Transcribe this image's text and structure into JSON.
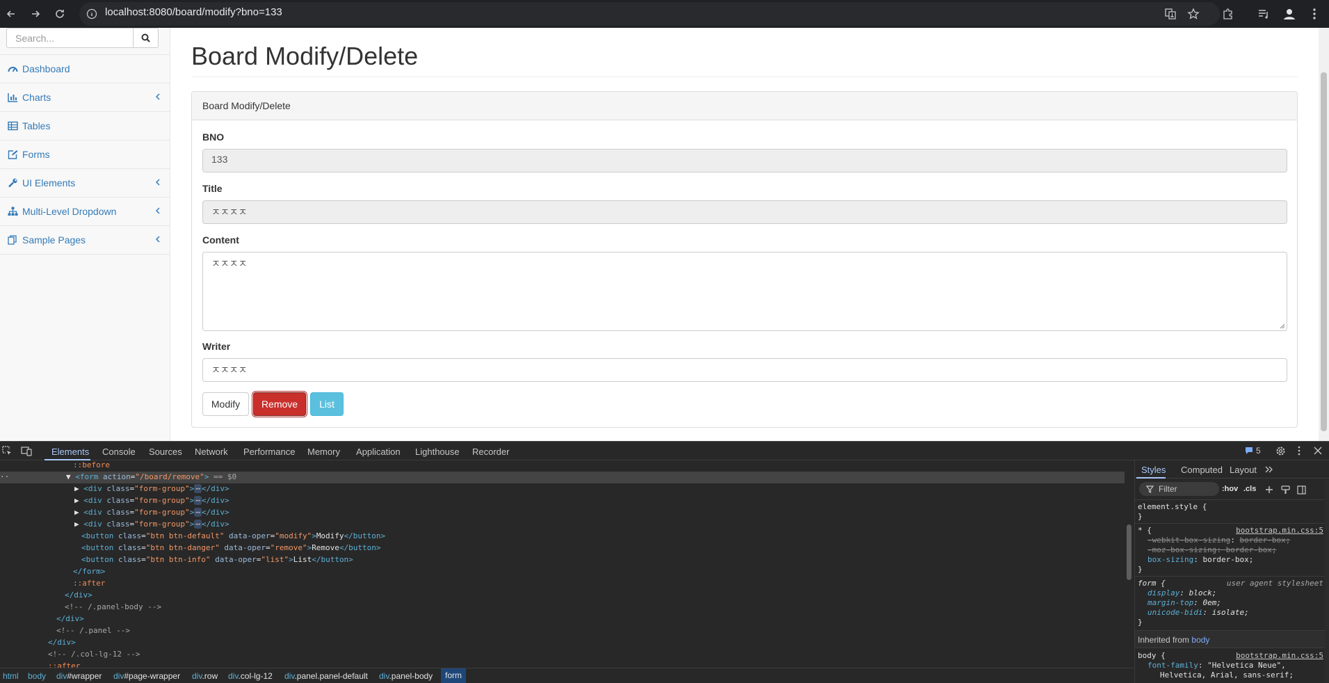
{
  "browser": {
    "url": "localhost:8080/board/modify?bno=133"
  },
  "sidebar": {
    "search_placeholder": "Search...",
    "items": [
      {
        "label": "Dashboard",
        "icon": "dashboard-icon",
        "has_children": false
      },
      {
        "label": "Charts",
        "icon": "bar-chart-icon",
        "has_children": true
      },
      {
        "label": "Tables",
        "icon": "table-icon",
        "has_children": false
      },
      {
        "label": "Forms",
        "icon": "edit-icon",
        "has_children": false
      },
      {
        "label": "UI Elements",
        "icon": "wrench-icon",
        "has_children": true
      },
      {
        "label": "Multi-Level Dropdown",
        "icon": "sitemap-icon",
        "has_children": true
      },
      {
        "label": "Sample Pages",
        "icon": "files-icon",
        "has_children": true
      }
    ]
  },
  "main": {
    "page_title": "Board Modify/Delete",
    "panel_heading": "Board Modify/Delete",
    "fields": {
      "bno_label": "BNO",
      "bno_value": "133",
      "title_label": "Title",
      "title_value": "ㅈㅈㅈㅈ",
      "content_label": "Content",
      "content_value": "ㅈㅈㅈㅈ",
      "writer_label": "Writer",
      "writer_value": "ㅈㅈㅈㅈ"
    },
    "buttons": {
      "modify": "Modify",
      "remove": "Remove",
      "list": "List"
    }
  },
  "devtools": {
    "tabs": [
      "Elements",
      "Console",
      "Sources",
      "Network",
      "Performance",
      "Memory",
      "Application",
      "Lighthouse",
      "Recorder"
    ],
    "active_tab": "Elements",
    "issues_count": "5",
    "elements_lines": {
      "before": "::before",
      "form_open_tag": "form",
      "form_attr": "action",
      "form_attr_val": "\"/board/remove\"",
      "form_eq": "== $0",
      "div_tag": "div",
      "class_attr": "class",
      "form_group_val": "\"form-group\"",
      "ellipsis": "⋯",
      "div_close": "</div>",
      "btn_tag": "button",
      "btn_default_val": "\"btn btn-default\"",
      "btn_danger_val": "\"btn btn-danger\"",
      "btn_info_val": "\"btn btn-info\"",
      "data_oper_attr": "data-oper",
      "modify_val": "\"modify\"",
      "remove_val": "\"remove\"",
      "list_val": "\"list\"",
      "modify_text": "Modify",
      "remove_text": "Remove",
      "list_text": "List",
      "btn_close": "</button>",
      "form_close": "</form>",
      "after": "::after",
      "panel_body_comment": "<!-- /.panel-body -->",
      "panel_comment": "<!-- /.panel -->",
      "col_comment": "<!-- /.col-lg-12 -->",
      "after2": "::after"
    },
    "styles": {
      "tabs": [
        "Styles",
        "Computed",
        "Layout"
      ],
      "filter_placeholder": "Filter",
      "hov": ":hov",
      "cls": ".cls",
      "element_style": "element.style {",
      "close_brace": "}",
      "universal_sel": "* {",
      "bootstrap_src": "bootstrap.min.css:5",
      "webkit_prop": "-webkit-box-sizing",
      "moz_prop": "-moz-box-sizing",
      "box_sizing_prop": "box-sizing",
      "border_box": "border-box;",
      "form_sel": "form {",
      "ua_stylesheet": "user agent stylesheet",
      "display_prop": "display",
      "display_val": "block;",
      "margin_prop": "margin-top",
      "margin_val": "0em;",
      "unicode_prop": "unicode-bidi",
      "unicode_val": "isolate;",
      "inherited_label": "Inherited from",
      "inherited_el": "body",
      "body_sel": "body {",
      "font_family_prop": "font-family",
      "font_family_val1": "\"Helvetica Neue\",",
      "font_family_val2": "Helvetica, Arial, sans-serif;"
    },
    "breadcrumbs": [
      {
        "tag": "html",
        "id": ""
      },
      {
        "tag": "body",
        "id": ""
      },
      {
        "tag": "div",
        "id": "#wrapper"
      },
      {
        "tag": "div",
        "id": "#page-wrapper"
      },
      {
        "tag": "div",
        "id": ".row"
      },
      {
        "tag": "div",
        "id": ".col-lg-12"
      },
      {
        "tag": "div",
        "id": ".panel.panel-default"
      },
      {
        "tag": "div",
        "id": ".panel-body"
      },
      {
        "tag": "form",
        "id": ""
      }
    ]
  }
}
